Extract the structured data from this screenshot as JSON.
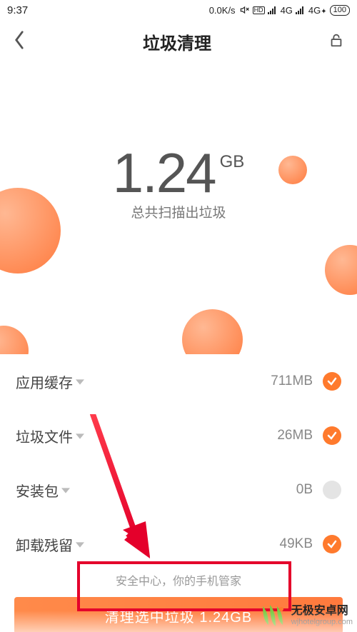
{
  "status": {
    "time": "9:37",
    "net_speed": "0.0K/s",
    "net_label_1": "4G",
    "net_label_2": "4G",
    "battery": "100"
  },
  "header": {
    "title": "垃圾清理"
  },
  "hero": {
    "value": "1.24",
    "unit": "GB",
    "subtitle": "总共扫描出垃圾"
  },
  "rows": [
    {
      "label": "应用缓存",
      "size": "711MB",
      "checked": true
    },
    {
      "label": "垃圾文件",
      "size": "26MB",
      "checked": true
    },
    {
      "label": "安装包",
      "size": "0B",
      "checked": false
    },
    {
      "label": "卸载残留",
      "size": "49KB",
      "checked": true
    }
  ],
  "footer": {
    "hint": "安全中心，你的手机管家",
    "cta": "清理选中垃圾 1.24GB"
  },
  "watermark": {
    "line1": "无极安卓网",
    "line2": "wjhotelgroup.com"
  }
}
